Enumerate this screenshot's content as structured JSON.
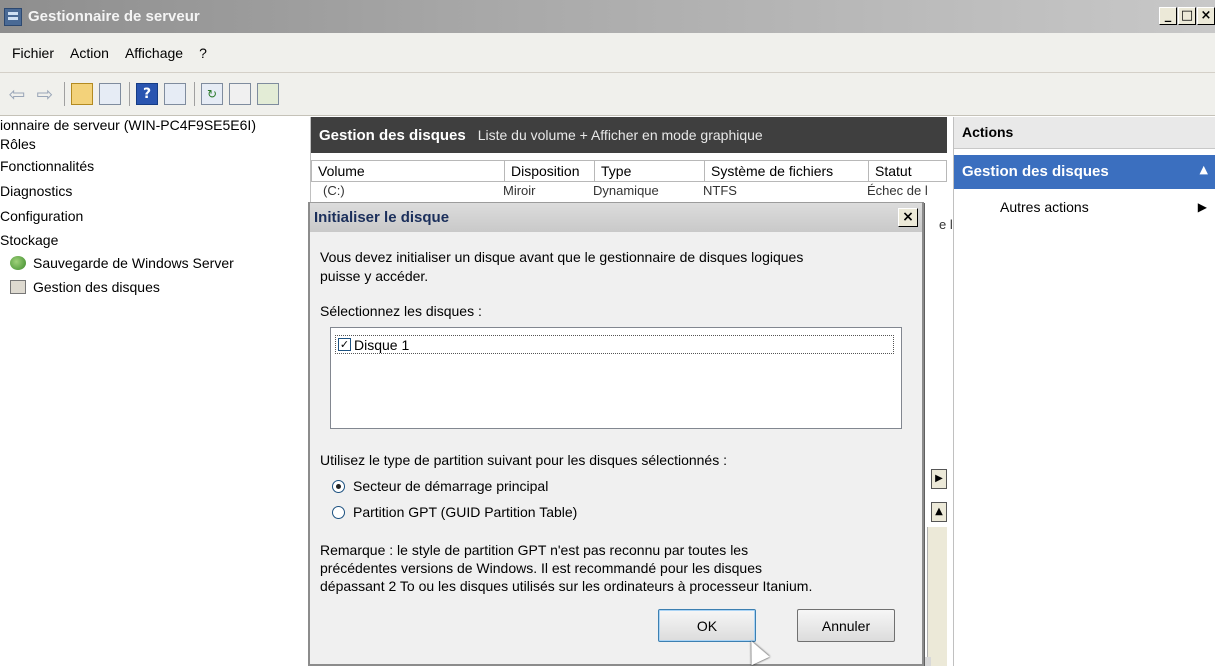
{
  "window": {
    "title": "Gestionnaire de serveur",
    "buttons": {
      "minimize": "_",
      "maximize": "□",
      "close": "×"
    }
  },
  "menu": [
    "Fichier",
    "Action",
    "Affichage",
    "?"
  ],
  "toolbar": {
    "icons": [
      "back-arrow-icon",
      "forward-arrow-icon",
      "up-folder-icon",
      "console-tree-icon",
      "help-icon",
      "action-pane-icon",
      "refresh-icon",
      "properties-icon",
      "export-icon"
    ]
  },
  "tree": {
    "items": [
      "ionnaire de serveur (WIN-PC4F9SE5E6I)",
      "Rôles",
      "Fonctionnalités",
      "Diagnostics",
      "Configuration",
      "Stockage"
    ],
    "children": [
      "Sauvegarde de Windows Server",
      "Gestion des disques"
    ]
  },
  "center": {
    "header_title": "Gestion des disques",
    "header_sub": "Liste du volume + Afficher en mode graphique",
    "columns": [
      "Volume",
      "Disposition",
      "Type",
      "Système de fichiers",
      "Statut"
    ],
    "row_partial": [
      "(C:)",
      "Miroir",
      "Dynamique",
      "NTFS",
      "Échec de l"
    ],
    "row_partial_2": "e l"
  },
  "actions": {
    "header": "Actions",
    "section": "Gestion des disques",
    "item": "Autres actions"
  },
  "dialog": {
    "title": "Initialiser le disque",
    "intro_line1": "Vous devez initialiser un disque avant que le gestionnaire de disques logiques",
    "intro_line2": "puisse y accéder.",
    "select_label": "Sélectionnez les disques :",
    "disks": [
      {
        "label": "Disque 1",
        "checked": true
      }
    ],
    "partition_label": "Utilisez le type de partition suivant pour les disques sélectionnés :",
    "options": [
      {
        "label": "Secteur de démarrage principal",
        "selected": true
      },
      {
        "label": "Partition GPT (GUID Partition Table)",
        "selected": false
      }
    ],
    "note_line1": "Remarque : le style de partition GPT n'est pas reconnu par toutes les",
    "note_line2": "précédentes versions de Windows. Il est recommandé pour les disques",
    "note_line3": "dépassant 2 To ou les disques utilisés sur les ordinateurs à processeur Itanium.",
    "ok": "OK",
    "cancel": "Annuler",
    "close": "×"
  }
}
